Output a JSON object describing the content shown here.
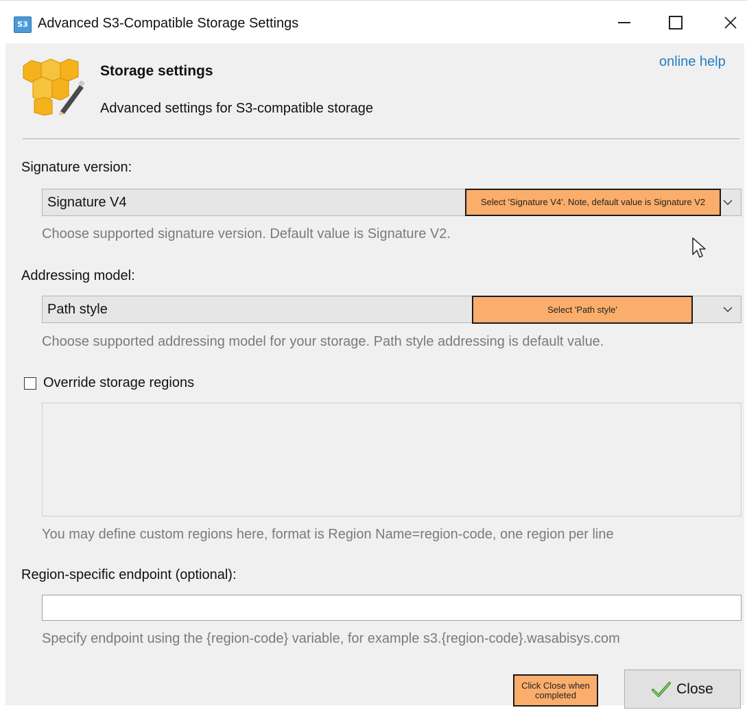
{
  "window": {
    "title": "Advanced S3-Compatible Storage Settings",
    "app_icon_text": "S3"
  },
  "header": {
    "title": "Storage settings",
    "subtitle": "Advanced settings for S3-compatible storage",
    "help_link": "online help",
    "icon": "storage-boxes-pencil-icon"
  },
  "signature": {
    "label": "Signature version:",
    "value": "Signature V4",
    "hint": "Choose supported signature version. Default value is Signature V2.",
    "callout": "Select 'Signature V4'. Note, default value is Signature V2"
  },
  "addressing": {
    "label": "Addressing model:",
    "value": "Path style",
    "hint": "Choose supported addressing model for your storage. Path style addressing is default value.",
    "callout": "Select 'Path style'"
  },
  "regions": {
    "checkbox_label": "Override storage regions",
    "checked": false,
    "textarea_value": "",
    "hint": "You may define custom regions here, format is Region Name=region-code, one region per line"
  },
  "endpoint": {
    "label": "Region-specific endpoint (optional):",
    "value": "",
    "hint": "Specify endpoint using the {region-code} variable, for example s3.{region-code}.wasabisys.com"
  },
  "footer": {
    "callout": "Click Close when completed",
    "close_label": "Close"
  },
  "colors": {
    "callout_bg": "#fbae6b",
    "link": "#1e7ec4",
    "icon_box": "#f5b21d"
  }
}
